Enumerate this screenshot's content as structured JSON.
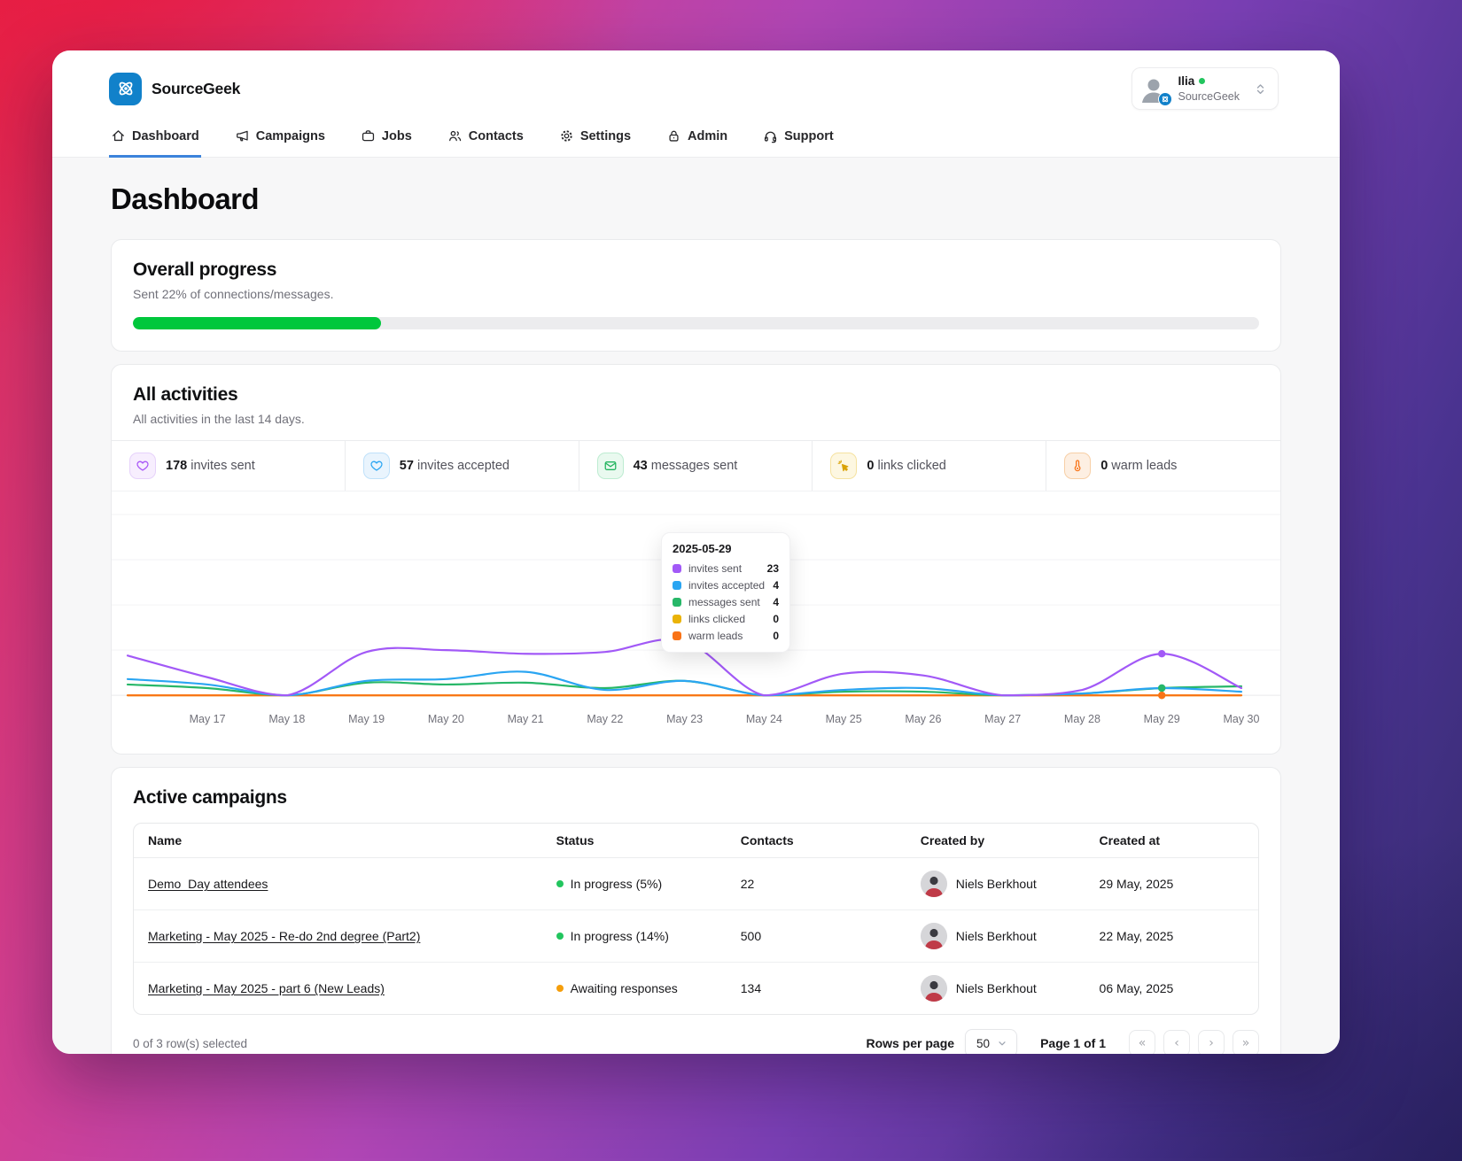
{
  "brand": {
    "name": "SourceGeek"
  },
  "header": {
    "user": {
      "name": "Ilia",
      "org": "SourceGeek",
      "status_color": "#22c55e"
    }
  },
  "nav": {
    "items": [
      {
        "label": "Dashboard",
        "active": true
      },
      {
        "label": "Campaigns",
        "active": false
      },
      {
        "label": "Jobs",
        "active": false
      },
      {
        "label": "Contacts",
        "active": false
      },
      {
        "label": "Settings",
        "active": false
      },
      {
        "label": "Admin",
        "active": false
      },
      {
        "label": "Support",
        "active": false
      }
    ]
  },
  "page": {
    "title": "Dashboard"
  },
  "overall_progress": {
    "title": "Overall progress",
    "subtitle": "Sent 22% of connections/messages.",
    "percent": 22,
    "bar_color": "#00c73c"
  },
  "activities": {
    "title": "All activities",
    "subtitle": "All activities in the last 14 days.",
    "stats": [
      {
        "value": "178",
        "label": "invites sent",
        "color": "#a855f7"
      },
      {
        "value": "57",
        "label": "invites accepted",
        "color": "#2aa5f2"
      },
      {
        "value": "43",
        "label": "messages sent",
        "color": "#22c55e"
      },
      {
        "value": "0",
        "label": "links clicked",
        "color": "#eab308"
      },
      {
        "value": "0",
        "label": "warm leads",
        "color": "#f97316"
      }
    ]
  },
  "chart_data": {
    "type": "line",
    "title": "All activities in the last 14 days",
    "xlabel": "",
    "ylabel": "",
    "x": [
      "May 17",
      "May 18",
      "May 19",
      "May 20",
      "May 21",
      "May 22",
      "May 23",
      "May 24",
      "May 25",
      "May 26",
      "May 27",
      "May 28",
      "May 29",
      "May 30"
    ],
    "series": [
      {
        "name": "invites sent",
        "color": "#a259f7",
        "edge_value": 22,
        "values": [
          10,
          0,
          24,
          25,
          23,
          24,
          30,
          0,
          12,
          11,
          0,
          3,
          23,
          4
        ]
      },
      {
        "name": "invites accepted",
        "color": "#2aa5f2",
        "edge_value": 9,
        "values": [
          6,
          0,
          8,
          9,
          13,
          3,
          8,
          0,
          3,
          4,
          0,
          1,
          4,
          2
        ]
      },
      {
        "name": "messages sent",
        "color": "#27b768",
        "edge_value": 6,
        "values": [
          4,
          0,
          7,
          6,
          7,
          4,
          8,
          0,
          2,
          2,
          0,
          1,
          4,
          5
        ]
      },
      {
        "name": "links clicked",
        "color": "#eab308",
        "edge_value": 0,
        "values": [
          0,
          0,
          0,
          0,
          0,
          0,
          0,
          0,
          0,
          0,
          0,
          0,
          0,
          0
        ]
      },
      {
        "name": "warm leads",
        "color": "#f97316",
        "edge_value": 0,
        "values": [
          0,
          0,
          0,
          0,
          0,
          0,
          0,
          0,
          0,
          0,
          0,
          0,
          0,
          0
        ]
      }
    ],
    "ylim": [
      0,
      100
    ],
    "grid": true,
    "legend_position": "tooltip",
    "highlight_index": 12,
    "tooltip": {
      "title": "2025-05-29",
      "rows": [
        {
          "label": "invites sent",
          "value": "23",
          "color": "#a259f7"
        },
        {
          "label": "invites accepted",
          "value": "4",
          "color": "#2aa5f2"
        },
        {
          "label": "messages sent",
          "value": "4",
          "color": "#27b768"
        },
        {
          "label": "links clicked",
          "value": "0",
          "color": "#eab308"
        },
        {
          "label": "warm leads",
          "value": "0",
          "color": "#f97316"
        }
      ]
    }
  },
  "campaigns": {
    "title": "Active campaigns",
    "columns": [
      "Name",
      "Status",
      "Contacts",
      "Created by",
      "Created at"
    ],
    "rows": [
      {
        "name": "Demo_Day attendees",
        "status": "In progress (5%)",
        "status_color": "#22c55e",
        "contacts": "22",
        "created_by": "Niels Berkhout",
        "created_at": "29 May, 2025"
      },
      {
        "name": "Marketing - May 2025 - Re-do 2nd degree (Part2)",
        "status": "In progress (14%)",
        "status_color": "#22c55e",
        "contacts": "500",
        "created_by": "Niels Berkhout",
        "created_at": "22 May, 2025"
      },
      {
        "name": "Marketing - May 2025 - part 6 (New Leads)",
        "status": "Awaiting responses",
        "status_color": "#f59e0b",
        "contacts": "134",
        "created_by": "Niels Berkhout",
        "created_at": "06 May, 2025"
      }
    ],
    "footer": {
      "selected_text": "0 of 3 row(s) selected",
      "rows_per_page_label": "Rows per page",
      "rows_per_page_value": "50",
      "page_text": "Page 1 of 1",
      "pagination": [
        "«",
        "‹",
        "›",
        "»"
      ]
    }
  }
}
